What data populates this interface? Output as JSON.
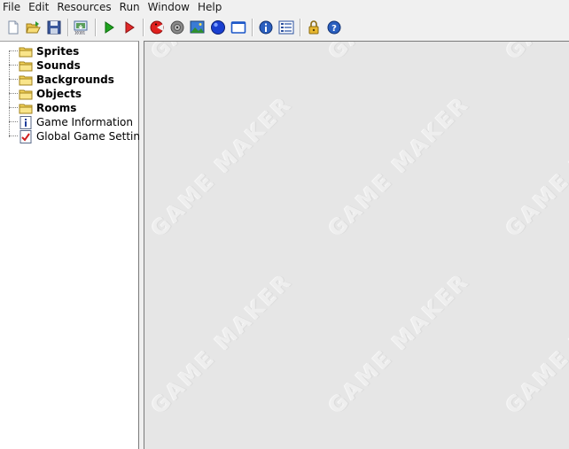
{
  "menu": {
    "items": [
      "File",
      "Edit",
      "Resources",
      "Run",
      "Window",
      "Help"
    ]
  },
  "toolbar": {
    "buttons": [
      {
        "name": "new-icon"
      },
      {
        "name": "open-icon"
      },
      {
        "name": "save-icon"
      },
      {
        "sep": true
      },
      {
        "name": "create-executable-icon"
      },
      {
        "sep": true
      },
      {
        "name": "run-normal-icon"
      },
      {
        "name": "run-debug-icon"
      },
      {
        "sep": true
      },
      {
        "name": "add-sprite-icon"
      },
      {
        "name": "add-sound-icon"
      },
      {
        "name": "add-background-icon"
      },
      {
        "name": "add-object-icon"
      },
      {
        "name": "add-room-icon"
      },
      {
        "sep": true
      },
      {
        "name": "game-information-icon"
      },
      {
        "name": "global-settings-icon"
      },
      {
        "sep": true
      },
      {
        "name": "upgrade-icon"
      },
      {
        "name": "help-icon"
      }
    ]
  },
  "tree": {
    "items": [
      {
        "label": "Sprites",
        "type": "folder",
        "bold": true
      },
      {
        "label": "Sounds",
        "type": "folder",
        "bold": true
      },
      {
        "label": "Backgrounds",
        "type": "folder",
        "bold": true
      },
      {
        "label": "Objects",
        "type": "folder",
        "bold": true
      },
      {
        "label": "Rooms",
        "type": "folder",
        "bold": true
      },
      {
        "label": "Game Information",
        "type": "info",
        "bold": false
      },
      {
        "label": "Global Game Settings",
        "type": "settings",
        "bold": false
      }
    ]
  },
  "workspace": {
    "watermark_text": "GAME MAKER"
  }
}
